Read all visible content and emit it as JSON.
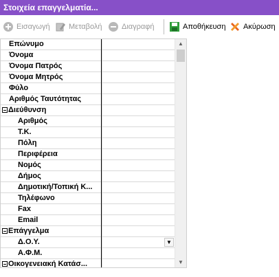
{
  "window": {
    "title": "Στοιχεία επαγγελματία..."
  },
  "toolbar": {
    "insert_label": "Εισαγωγή",
    "edit_label": "Μεταβολή",
    "delete_label": "Διαγραφή",
    "save_label": "Αποθήκευση",
    "cancel_label": "Ακύρωση"
  },
  "grid": {
    "rows": [
      {
        "label": "Επώνυμο",
        "value": ""
      },
      {
        "label": "Όνομα",
        "value": ""
      },
      {
        "label": "Όνομα Πατρός",
        "value": ""
      },
      {
        "label": "Όνομα Μητρός",
        "value": ""
      },
      {
        "label": "Φύλο",
        "value": ""
      },
      {
        "label": "Αριθμός Ταυτότητας",
        "value": ""
      },
      {
        "label": "Διεύθυνση",
        "value": ""
      },
      {
        "label": "Αριθμός",
        "value": ""
      },
      {
        "label": "Τ.Κ.",
        "value": ""
      },
      {
        "label": "Πόλη",
        "value": ""
      },
      {
        "label": "Περιφέρεια",
        "value": ""
      },
      {
        "label": "Νομός",
        "value": ""
      },
      {
        "label": "Δήμος",
        "value": ""
      },
      {
        "label": "Δημοτική/Τοπική Κ...",
        "value": ""
      },
      {
        "label": "Τηλέφωνο",
        "value": ""
      },
      {
        "label": "Fax",
        "value": ""
      },
      {
        "label": "Email",
        "value": ""
      },
      {
        "label": "Επάγγελμα",
        "value": ""
      },
      {
        "label": "Δ.Ο.Υ.",
        "value": ""
      },
      {
        "label": "Α.Φ.Μ.",
        "value": ""
      },
      {
        "label": "Οικογενειακή Κατάσ...",
        "value": ""
      }
    ]
  },
  "colors": {
    "title_bar": "#8750c8",
    "title_text": "#ffffff",
    "grid_line": "#d8d8d8"
  },
  "icons": {
    "insert": "plus-circle-icon",
    "edit": "edit-icon",
    "delete": "minus-circle-icon",
    "save": "save-icon",
    "cancel": "cancel-icon"
  }
}
